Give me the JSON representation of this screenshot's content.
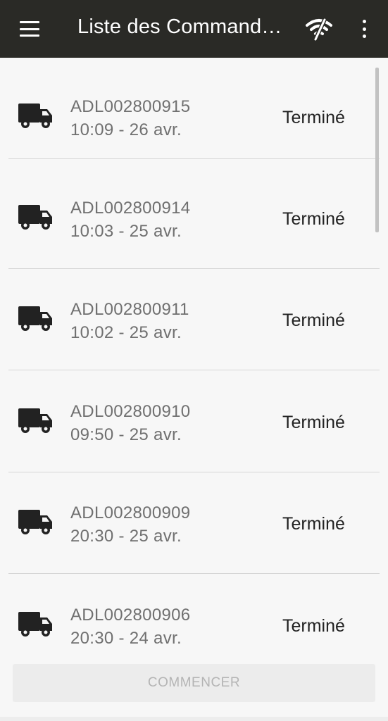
{
  "appbar": {
    "title": "Liste des Command…",
    "menu_icon": "hamburger-menu-icon",
    "network_icon": "wifi-off-icon",
    "overflow_icon": "more-vertical-icon",
    "background": "#2a2a26"
  },
  "orders": [
    {
      "id": "ADL002800915",
      "time": "10:09 - 26 avr.",
      "status": "Terminé",
      "icon": "truck-icon"
    },
    {
      "id": "ADL002800914",
      "time": "10:03 - 25 avr.",
      "status": "Terminé",
      "icon": "truck-icon"
    },
    {
      "id": "ADL002800911",
      "time": "10:02 - 25 avr.",
      "status": "Terminé",
      "icon": "truck-icon"
    },
    {
      "id": "ADL002800910",
      "time": "09:50 - 25 avr.",
      "status": "Terminé",
      "icon": "truck-icon"
    },
    {
      "id": "ADL002800909",
      "time": "20:30 - 25 avr.",
      "status": "Terminé",
      "icon": "truck-icon"
    },
    {
      "id": "ADL002800906",
      "time": "20:30 - 24 avr.",
      "status": "Terminé",
      "icon": "truck-icon"
    }
  ],
  "footer": {
    "start_label": "COMMENCER",
    "start_enabled": false
  }
}
